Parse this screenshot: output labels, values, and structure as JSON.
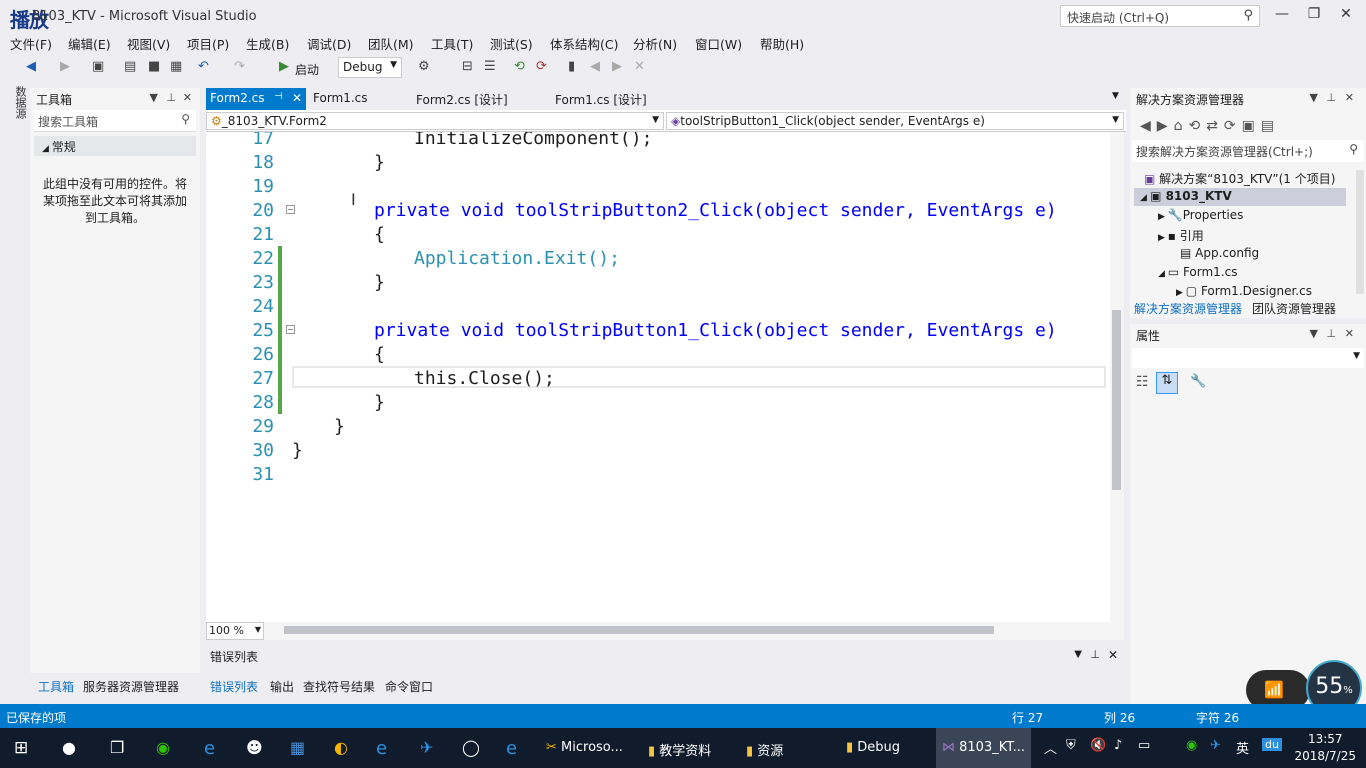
{
  "window": {
    "logo": "播放",
    "title": "8103_KTV - Microsoft Visual Studio",
    "quick_launch": "快速启动 (Ctrl+Q)"
  },
  "menu": [
    "文件(F)",
    "编辑(E)",
    "视图(V)",
    "项目(P)",
    "生成(B)",
    "调试(D)",
    "团队(M)",
    "工具(T)",
    "测试(S)",
    "体系结构(C)",
    "分析(N)",
    "窗口(W)",
    "帮助(H)"
  ],
  "toolbar": {
    "start_label": "启动",
    "config": "Debug"
  },
  "left_vertical_tab": "数据源",
  "toolbox": {
    "title": "工具箱",
    "search_placeholder": "搜索工具箱",
    "section": "常规",
    "empty_text": "此组中没有可用的控件。将某项拖至此文本可将其添加到工具箱。"
  },
  "doc_tabs": [
    {
      "label": "Form2.cs",
      "active": true
    },
    {
      "label": "Form1.cs",
      "active": false
    },
    {
      "label": "Form2.cs [设计]",
      "active": false
    },
    {
      "label": "Form1.cs [设计]",
      "active": false
    }
  ],
  "nav": {
    "type": "_8103_KTV.Form2",
    "member": "toolStripButton1_Click(object sender, EventArgs e)"
  },
  "code_lines": [
    {
      "n": "17",
      "text": "InitializeComponent();"
    },
    {
      "n": "18",
      "text": "}"
    },
    {
      "n": "19",
      "text": ""
    },
    {
      "n": "20",
      "text": "private void toolStripButton2_Click(object sender, EventArgs e)"
    },
    {
      "n": "21",
      "text": "{"
    },
    {
      "n": "22",
      "text": "Application.Exit();"
    },
    {
      "n": "23",
      "text": "}"
    },
    {
      "n": "24",
      "text": ""
    },
    {
      "n": "25",
      "text": "private void toolStripButton1_Click(object sender, EventArgs e)"
    },
    {
      "n": "26",
      "text": "{"
    },
    {
      "n": "27",
      "text": "this.Close();"
    },
    {
      "n": "28",
      "text": "}"
    },
    {
      "n": "29",
      "text": "}"
    },
    {
      "n": "30",
      "text": "}"
    },
    {
      "n": "31",
      "text": ""
    }
  ],
  "zoom": "100 %",
  "error_list_title": "错误列表",
  "bottom_tabs": [
    "错误列表",
    "输出",
    "查找符号结果",
    "命令窗口"
  ],
  "left_bottom_tabs": [
    "工具箱",
    "服务器资源管理器"
  ],
  "solution_explorer": {
    "title": "解决方案资源管理器",
    "search_placeholder": "搜索解决方案资源管理器(Ctrl+;)",
    "tree": [
      "解决方案“8103_KTV”(1 个项目)",
      "8103_KTV",
      "Properties",
      "引用",
      "App.config",
      "Form1.cs",
      "Form1.Designer.cs"
    ],
    "tabs": [
      "解决方案资源管理器",
      "团队资源管理器"
    ]
  },
  "properties": {
    "title": "属性"
  },
  "status": {
    "left": "已保存的项",
    "row": "行 27",
    "col": "列 26",
    "char": "字符 26"
  },
  "taskbar": {
    "apps": [
      "Microso...",
      "教学资料",
      "资源",
      "Debug",
      "8103_KT..."
    ],
    "ime": "英",
    "time": "13:57",
    "date": "2018/7/25"
  },
  "overlay": {
    "percent": "55"
  }
}
